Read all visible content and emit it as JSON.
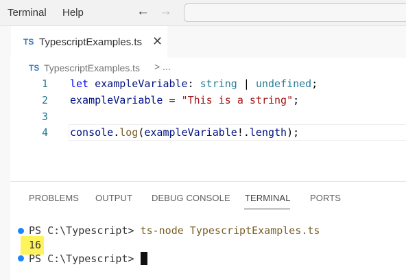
{
  "menu": {
    "terminal": "Terminal",
    "help": "Help"
  },
  "nav": {
    "back_glyph": "←",
    "forward_glyph": "→"
  },
  "tab": {
    "badge": "TS",
    "label": "TypescriptExamples.ts",
    "close_glyph": "✕"
  },
  "breadcrumb": {
    "badge": "TS",
    "file": "TypescriptExamples.ts",
    "sep": "> ..."
  },
  "editor": {
    "lines": [
      {
        "number": "1",
        "tokens": [
          {
            "t": "let",
            "c": "kw"
          },
          {
            "t": " ",
            "c": "pl"
          },
          {
            "t": "exampleVariable",
            "c": "id"
          },
          {
            "t": ": ",
            "c": "pl"
          },
          {
            "t": "string",
            "c": "ty"
          },
          {
            "t": " | ",
            "c": "pl"
          },
          {
            "t": "undefined",
            "c": "ty"
          },
          {
            "t": ";",
            "c": "pl"
          }
        ]
      },
      {
        "number": "2",
        "tokens": [
          {
            "t": "exampleVariable",
            "c": "id"
          },
          {
            "t": " = ",
            "c": "pl"
          },
          {
            "t": "\"This is a string\"",
            "c": "str"
          },
          {
            "t": ";",
            "c": "pl"
          }
        ]
      },
      {
        "number": "3",
        "tokens": []
      },
      {
        "number": "4",
        "tokens": [
          {
            "t": "console",
            "c": "id"
          },
          {
            "t": ".",
            "c": "pl"
          },
          {
            "t": "log",
            "c": "fn"
          },
          {
            "t": "(",
            "c": "pl"
          },
          {
            "t": "exampleVariable",
            "c": "id"
          },
          {
            "t": "!.",
            "c": "pl"
          },
          {
            "t": "length",
            "c": "id"
          },
          {
            "t": ");",
            "c": "pl"
          }
        ]
      }
    ]
  },
  "panel": {
    "tabs": [
      "PROBLEMS",
      "OUTPUT",
      "DEBUG CONSOLE",
      "TERMINAL",
      "PORTS"
    ],
    "active_tab": "TERMINAL"
  },
  "terminal": {
    "line1_prompt": "PS C:\\Typescript> ",
    "line1_command": "ts-node TypescriptExamples.ts",
    "output": "16",
    "line3_prompt": "PS C:\\Typescript> "
  },
  "colors": {
    "keyword": "#0000ff",
    "identifier": "#001080",
    "type": "#267f99",
    "string": "#a31515",
    "function": "#795e26",
    "line_number": "#237893",
    "terminal_dot": "#1a85ff",
    "highlight": "#fff35c"
  }
}
